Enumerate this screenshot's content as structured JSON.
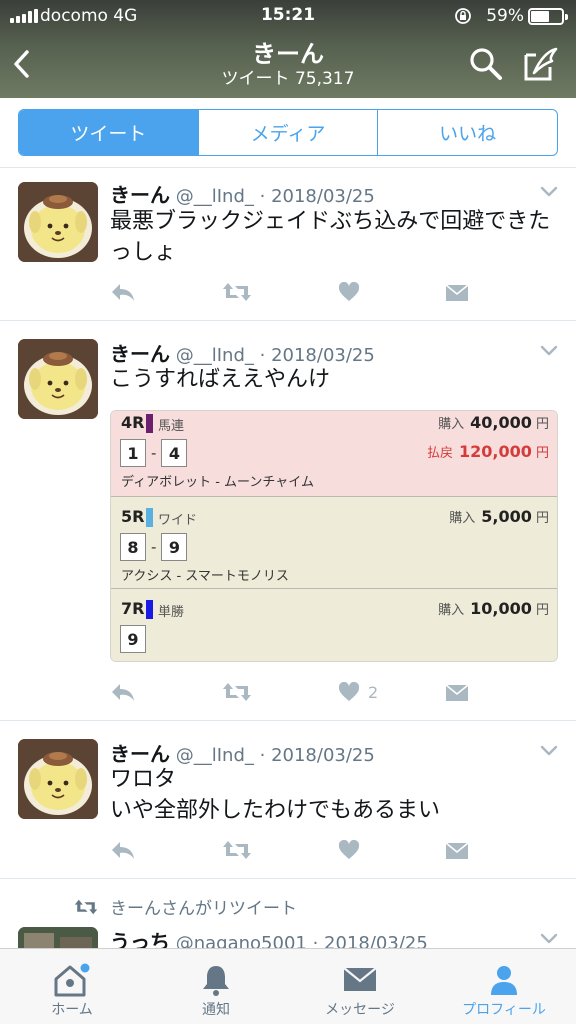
{
  "status_bar": {
    "carrier": "docomo   4G",
    "time": "15:21",
    "battery": "59%",
    "battery_level": 0.59
  },
  "header": {
    "title": "きーん",
    "subtitle": "ツイート 75,317"
  },
  "profile_tabs": [
    {
      "label": "ツイート",
      "active": true
    },
    {
      "label": "メディア",
      "active": false
    },
    {
      "label": "いいね",
      "active": false
    }
  ],
  "tweets": [
    {
      "name": "きーん",
      "handle": "@__lInd_",
      "date": "· 2018/03/25",
      "text": "最悪ブラックジェイドぶち込みで回避できたっしょ",
      "likes": ""
    },
    {
      "name": "きーん",
      "handle": "@__lInd_",
      "date": "· 2018/03/25",
      "text": "こうすればええやんけ",
      "likes": "2",
      "card": {
        "races": [
          {
            "race": "4R",
            "type": "馬連",
            "type_color": "#6b1f6e",
            "purchase_label": "購入",
            "purchase": "40,000",
            "unit": "円",
            "payout_label": "払戻",
            "payout": "120,000",
            "payout_unit": "円",
            "numbers": [
              "1",
              "4"
            ],
            "horses": "ディアボレット - ムーンチャイム"
          },
          {
            "race": "5R",
            "type": "ワイド",
            "type_color": "#5ab0e0",
            "purchase_label": "購入",
            "purchase": "5,000",
            "unit": "円",
            "numbers": [
              "8",
              "9"
            ],
            "horses": "アクシス - スマートモノリス"
          },
          {
            "race": "7R",
            "type": "単勝",
            "type_color": "#1a1ae6",
            "purchase_label": "購入",
            "purchase": "10,000",
            "unit": "円",
            "numbers": [
              "9"
            ],
            "horses": ""
          }
        ]
      }
    },
    {
      "name": "きーん",
      "handle": "@__lInd_",
      "date": "· 2018/03/25",
      "text": "ワロタ\nいや全部外したわけでもあるまい",
      "likes": ""
    }
  ],
  "retweet_notice": "きーんさんがリツイート",
  "retweeted_tweet": {
    "name": "うっち",
    "handle": "@nagano5001",
    "date": "· 2018/03/25"
  },
  "tab_bar": [
    {
      "label": "ホーム",
      "icon": "home-icon",
      "active": false
    },
    {
      "label": "通知",
      "icon": "bell-icon",
      "active": false
    },
    {
      "label": "メッセージ",
      "icon": "envelope-icon",
      "active": false
    },
    {
      "label": "プロフィール",
      "icon": "person-icon",
      "active": true
    }
  ],
  "colors": {
    "accent": "#4aa3ec",
    "text": "#14171a",
    "secondary": "#657786",
    "action_icon": "#aab8c2",
    "payout_red": "#d63b3b"
  }
}
